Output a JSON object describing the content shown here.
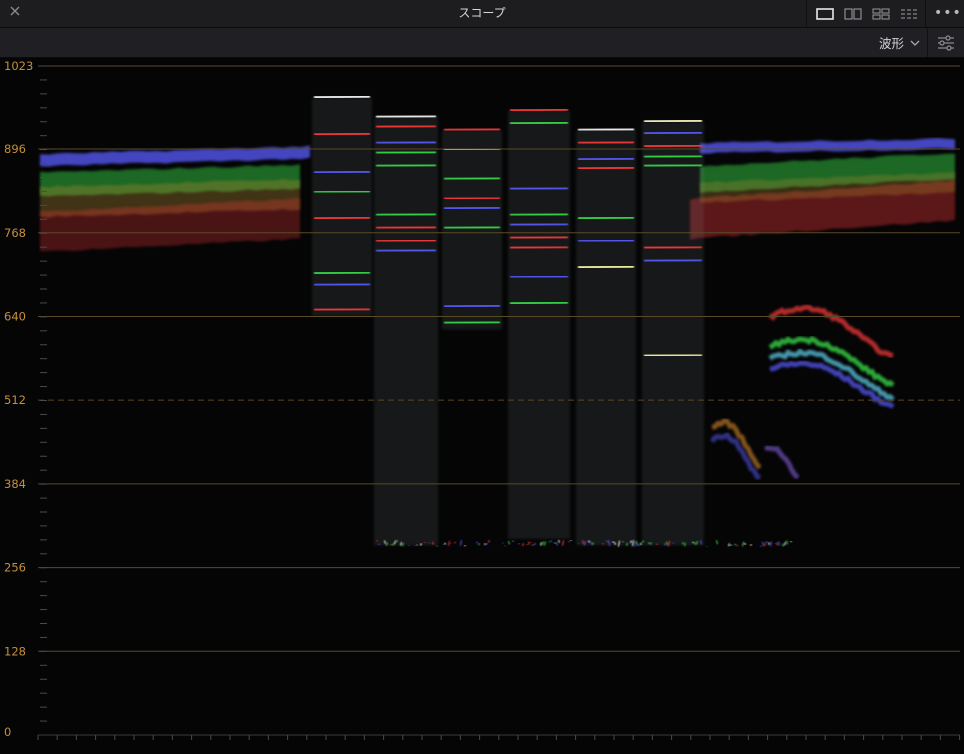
{
  "window": {
    "title": "スコープ",
    "close_icon": "close-icon",
    "layout_buttons": [
      {
        "name": "single-view",
        "icon": "layout-single-icon",
        "active": true
      },
      {
        "name": "dual-view",
        "icon": "layout-dual-icon",
        "active": false
      },
      {
        "name": "quad-view",
        "icon": "layout-quad-icon",
        "active": false
      },
      {
        "name": "grid-view",
        "icon": "layout-grid-icon",
        "active": false
      }
    ],
    "more_label": "•••"
  },
  "toolbar": {
    "scope_mode": "波形",
    "mode_chevron_icon": "chevron-down-icon",
    "settings_icon": "sliders-icon"
  },
  "scope": {
    "type": "waveform",
    "y_axis": {
      "min": 0,
      "max": 1023,
      "labels": [
        "1023",
        "896",
        "768",
        "640",
        "512",
        "384",
        "256",
        "128",
        "0"
      ],
      "values": [
        1023,
        896,
        768,
        640,
        512,
        384,
        256,
        128,
        0
      ],
      "dashed_value": 512
    },
    "colors": {
      "axis_label": "#c58f3a",
      "gridline": "#5a4a26",
      "red": "#ff3b3b",
      "green": "#38e04a",
      "blue": "#5a5cff"
    }
  }
}
